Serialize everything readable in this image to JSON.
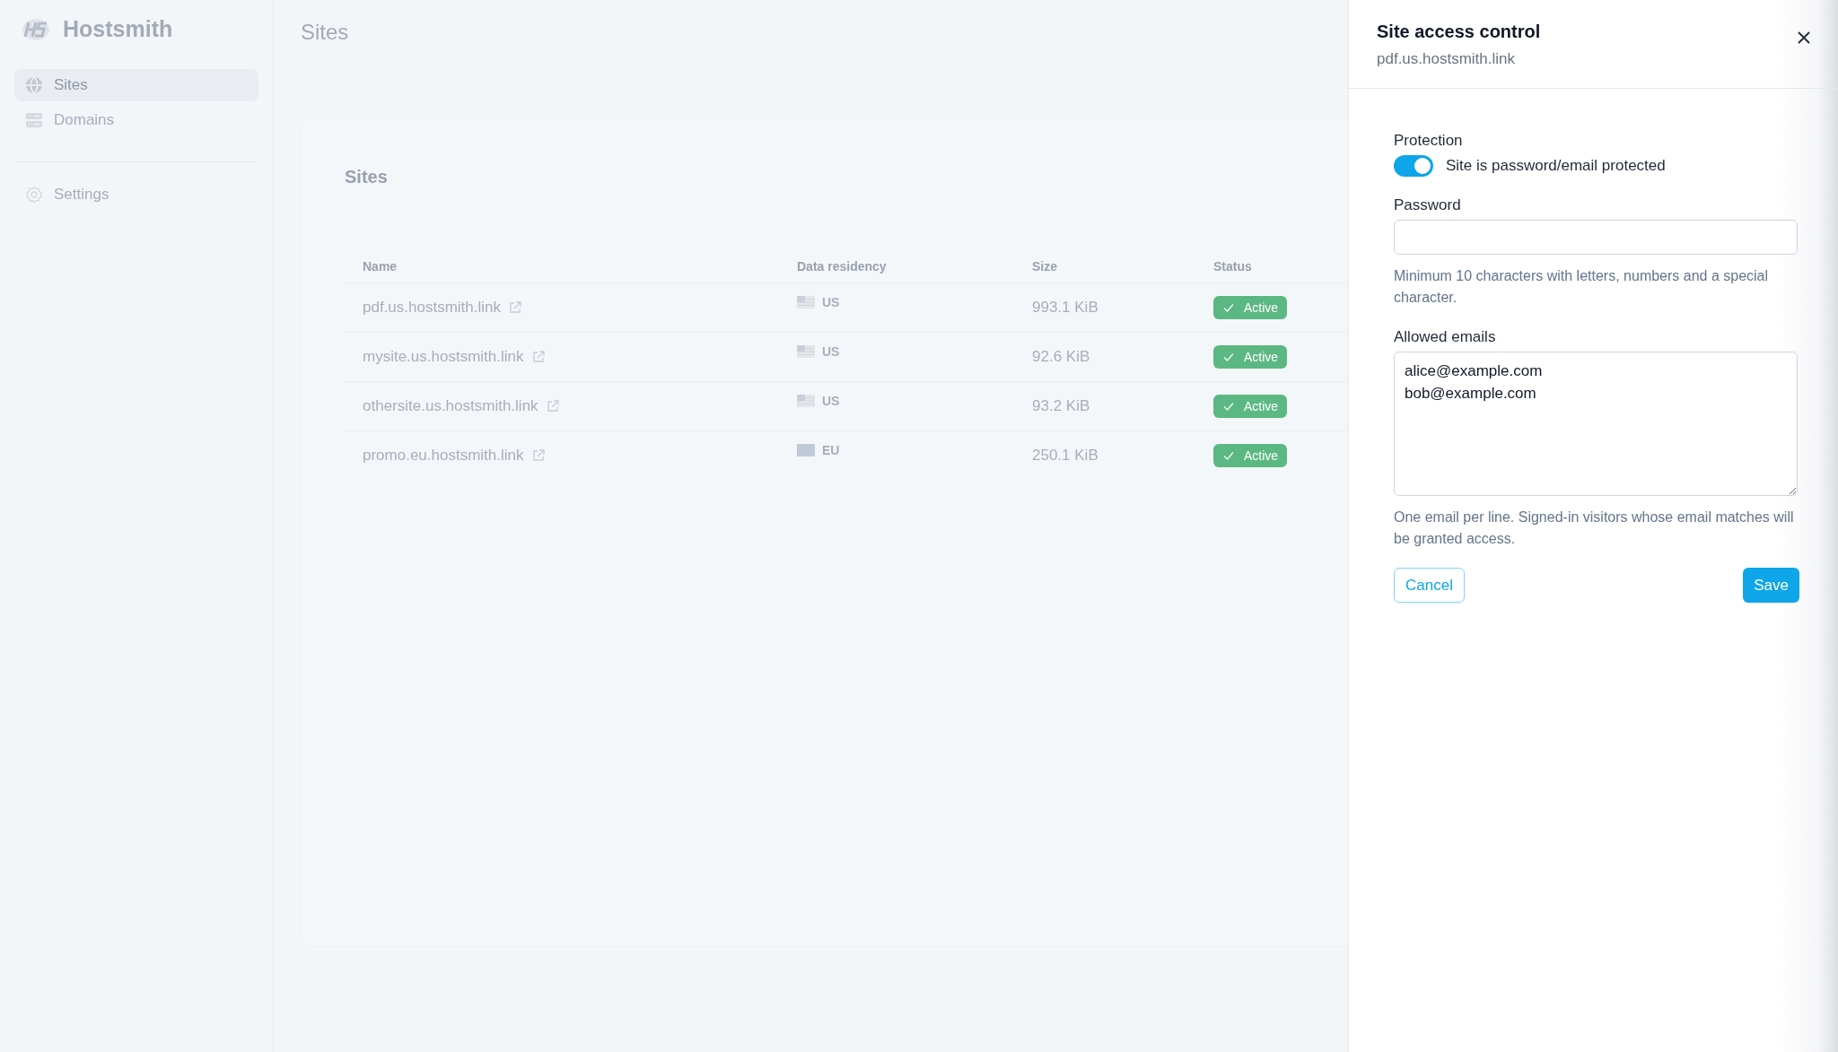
{
  "app": {
    "name": "Hostsmith"
  },
  "sidebar": {
    "items": [
      {
        "label": "Sites",
        "selected": true
      },
      {
        "label": "Domains",
        "selected": false
      },
      {
        "label": "Settings",
        "selected": false
      }
    ]
  },
  "page": {
    "title": "Sites"
  },
  "card": {
    "title": "Sites",
    "table": {
      "columns": [
        "Name",
        "Data residency",
        "Size",
        "Status"
      ],
      "rows": [
        {
          "name": "pdf.us.hostsmith.link",
          "kind": "striped_flag",
          "region": "US",
          "size": "993.1 KiB",
          "status": "Active"
        },
        {
          "name": "mysite.us.hostsmith.link",
          "kind": "striped_flag",
          "region": "US",
          "size": "92.6 KiB",
          "status": "Active"
        },
        {
          "name": "othersite.us.hostsmith.link",
          "kind": "striped_flag",
          "region": "US",
          "size": "93.2 KiB",
          "status": "Active"
        },
        {
          "name": "promo.eu.hostsmith.link",
          "kind": "plain_flag",
          "region": "EU",
          "size": "250.1 KiB",
          "status": "Active"
        }
      ]
    }
  },
  "panel": {
    "title": "Site access control",
    "subtitle": "pdf.us.hostsmith.link",
    "protection": {
      "label": "Protection",
      "toggle_label": "Site is password/email protected",
      "on": true
    },
    "password": {
      "label": "Password",
      "hint": "Minimum 10 characters with letters, numbers and a special character."
    },
    "allowed_emails": {
      "label": "Allowed emails",
      "value": [
        "alice@example.com",
        "bob@example.com"
      ],
      "hint": "One email per line. Signed-in visitors whose email matches will be granted access."
    },
    "buttons": {
      "cancel": "Cancel",
      "save": "Save"
    }
  }
}
